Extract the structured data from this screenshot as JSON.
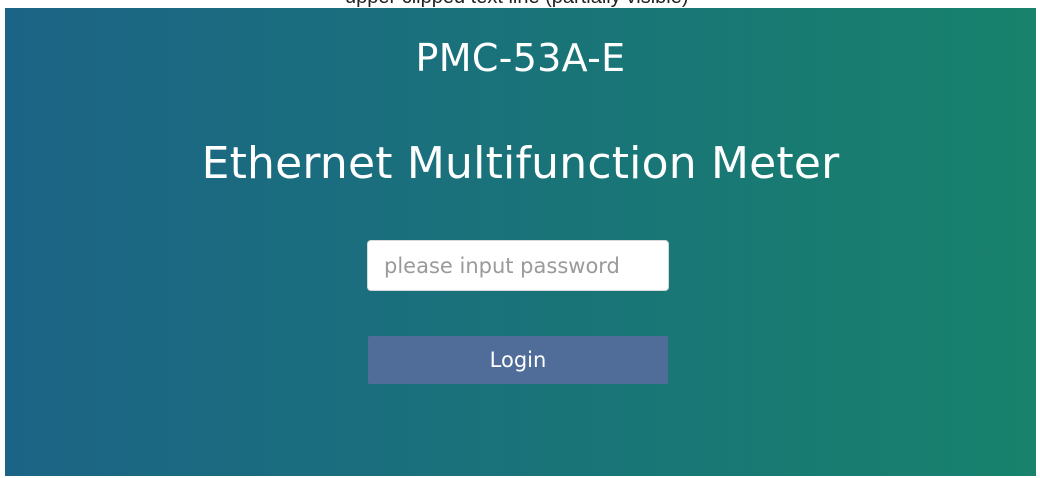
{
  "header_strip": {
    "text": "upper clipped text line (partially visible)"
  },
  "login": {
    "product_code": "PMC-53A-E",
    "product_name": "Ethernet Multifunction Meter",
    "password_placeholder": "please input password",
    "password_value": "",
    "login_label": "Login"
  },
  "colors": {
    "panel_gradient_start": "#1c6486",
    "panel_gradient_end": "#18826c",
    "button_background": "#506d9a",
    "text": "#ffffff"
  }
}
